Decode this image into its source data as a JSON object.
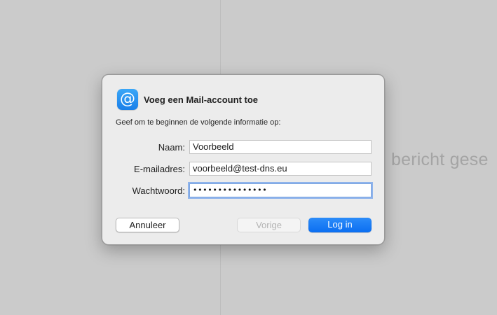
{
  "background": {
    "partial_text": "bericht gese"
  },
  "dialog": {
    "icon": {
      "name": "at-sign-icon",
      "glyph": "@",
      "color": "#1a7fe9"
    },
    "title": "Voeg een Mail-account toe",
    "instruction": "Geef om te beginnen de volgende informatie op:",
    "fields": {
      "name": {
        "label": "Naam:",
        "value": "Voorbeeld"
      },
      "email": {
        "label": "E-mailadres:",
        "value": "voorbeeld@test-dns.eu"
      },
      "password": {
        "label": "Wachtwoord:",
        "value": "•••••••••••••••"
      }
    },
    "buttons": {
      "cancel": "Annuleer",
      "previous": "Vorige",
      "login": "Log in"
    }
  },
  "colors": {
    "accent": "#0b6ef1",
    "focus_ring": "#8fb4ec",
    "backdrop": "#cbcbcb"
  }
}
